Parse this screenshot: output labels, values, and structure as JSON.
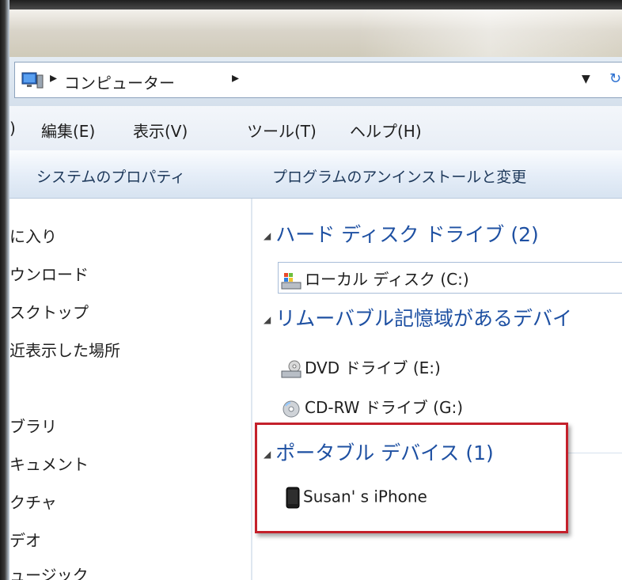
{
  "address": {
    "path": "コンピューター",
    "separator": "▸"
  },
  "menu": {
    "partial": ")",
    "edit": "編集(E)",
    "view": "表示(V)",
    "tools": "ツール(T)",
    "help": "ヘルプ(H)"
  },
  "commands": {
    "system_properties": "システムのプロパティ",
    "uninstall": "プログラムのアンインストールと変更"
  },
  "nav": {
    "items": [
      "に入り",
      "ウンロード",
      "スクトップ",
      "近表示した場所",
      "ブラリ",
      "キュメント",
      "クチャ",
      "デオ",
      "ュージック"
    ]
  },
  "groups": {
    "hdd": {
      "header": "ハード ディスク ドライブ (2)",
      "items": [
        "ローカル ディスク (C:)"
      ]
    },
    "removable": {
      "header": "リムーバブル記憶域があるデバイ",
      "items": [
        "DVD ドライブ (E:)",
        "CD-RW ドライブ (G:)"
      ]
    },
    "portable": {
      "header": "ポータブル デバイス (1)",
      "items": [
        "Susan' s iPhone"
      ]
    }
  },
  "colors": {
    "group_header": "#1e50a2",
    "highlight": "#c4202b"
  }
}
